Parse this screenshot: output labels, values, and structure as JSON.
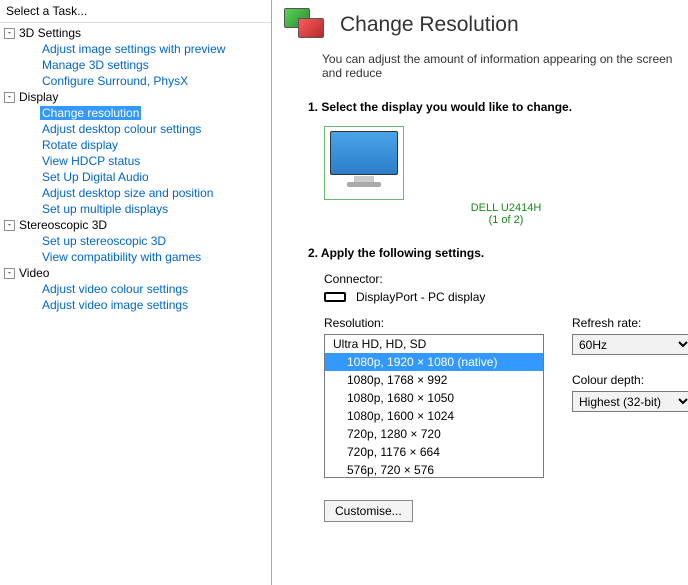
{
  "sidebar": {
    "header": "Select a Task...",
    "groups": [
      {
        "label": "3D Settings",
        "items": [
          "Adjust image settings with preview",
          "Manage 3D settings",
          "Configure Surround, PhysX"
        ]
      },
      {
        "label": "Display",
        "items": [
          "Change resolution",
          "Adjust desktop colour settings",
          "Rotate display",
          "View HDCP status",
          "Set Up Digital Audio",
          "Adjust desktop size and position",
          "Set up multiple displays"
        ]
      },
      {
        "label": "Stereoscopic 3D",
        "items": [
          "Set up stereoscopic 3D",
          "View compatibility with games"
        ]
      },
      {
        "label": "Video",
        "items": [
          "Adjust video colour settings",
          "Adjust video image settings"
        ]
      }
    ],
    "selected": "Change resolution"
  },
  "main": {
    "title": "Change Resolution",
    "description": "You can adjust the amount of information appearing on the screen and reduce",
    "step1": "1. Select the display you would like to change.",
    "monitor": {
      "name": "DELL U2414H",
      "sub": "(1 of 2)"
    },
    "step2": "2. Apply the following settings.",
    "connector_label": "Connector:",
    "connector_value": "DisplayPort - PC display",
    "resolution_label": "Resolution:",
    "refresh_label": "Refresh rate:",
    "refresh_value": "60Hz",
    "depth_label": "Colour depth:",
    "depth_value": "Highest (32-bit)",
    "resolutions": {
      "group": "Ultra HD, HD, SD",
      "items": [
        "1080p, 1920 × 1080 (native)",
        "1080p, 1768 × 992",
        "1080p, 1680 × 1050",
        "1080p, 1600 × 1024",
        "720p, 1280 × 720",
        "720p, 1176 × 664",
        "576p, 720 × 576"
      ],
      "selected_index": 0
    },
    "customise": "Customise..."
  }
}
